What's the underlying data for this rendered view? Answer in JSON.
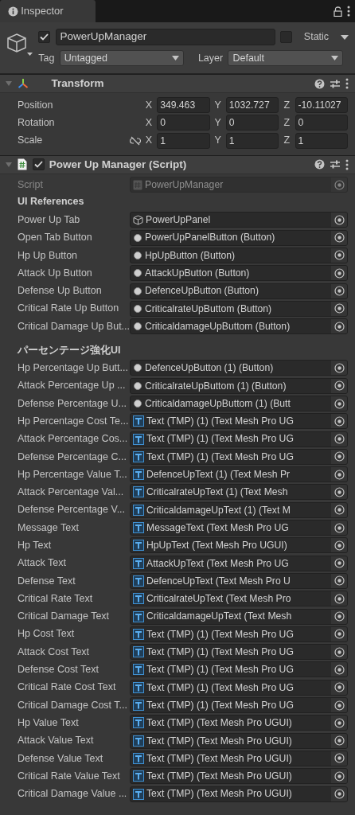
{
  "tab": {
    "title": "Inspector"
  },
  "object": {
    "active": true,
    "name": "PowerUpManager",
    "static": false,
    "static_label": "Static",
    "tag_label": "Tag",
    "tag": "Untagged",
    "layer_label": "Layer",
    "layer": "Default"
  },
  "transform": {
    "title": "Transform",
    "expanded": true,
    "rows": [
      {
        "label": "Position",
        "kind": "vector",
        "values": [
          {
            "axis": "X",
            "value": "349.463"
          },
          {
            "axis": "Y",
            "value": "1032.727"
          },
          {
            "axis": "Z",
            "value": "-10.11027"
          }
        ]
      },
      {
        "label": "Rotation",
        "kind": "vector",
        "values": [
          {
            "axis": "X",
            "value": "0"
          },
          {
            "axis": "Y",
            "value": "0"
          },
          {
            "axis": "Z",
            "value": "0"
          }
        ]
      },
      {
        "label": "Scale",
        "kind": "vector_link",
        "values": [
          {
            "axis": "X",
            "value": "1"
          },
          {
            "axis": "Y",
            "value": "1"
          },
          {
            "axis": "Z",
            "value": "1"
          }
        ]
      }
    ]
  },
  "script_component": {
    "title": "Power Up Manager (Script)",
    "expanded": true,
    "enabled": true,
    "script_label": "Script",
    "script": "PowerUpManager",
    "disabled": true
  },
  "sections": [
    {
      "heading": "UI References",
      "fields": [
        {
          "label": "Power Up Tab",
          "kind": "gameobject",
          "value": "PowerUpPanel"
        },
        {
          "label": "Open Tab Button",
          "kind": "button",
          "value": "PowerUpPanelButton (Button)"
        },
        {
          "label": "Hp Up Button",
          "kind": "button",
          "value": "HpUpButton (Button)"
        },
        {
          "label": "Attack Up Button",
          "kind": "button",
          "value": "AttackUpButton (Button)"
        },
        {
          "label": "Defense Up Button",
          "kind": "button",
          "value": "DefenceUpButton (Button)"
        },
        {
          "label": "Critical Rate Up Button",
          "kind": "button",
          "value": "CriticalrateUpButtom (Button)"
        },
        {
          "label": "Critical Damage Up But...",
          "kind": "button",
          "value": "CriticaldamageUpButtom (Button)"
        }
      ]
    },
    {
      "heading": "パーセンテージ強化UI",
      "fields": [
        {
          "label": "Hp Percentage Up Butt...",
          "kind": "button",
          "value": "DefenceUpButton (1) (Button)"
        },
        {
          "label": "Attack Percentage Up ...",
          "kind": "button",
          "value": "CriticalrateUpButtom (1) (Button)"
        },
        {
          "label": "Defense Percentage U...",
          "kind": "button",
          "value": "CriticaldamageUpButtom (1) (Butt"
        },
        {
          "label": "Hp Percentage Cost Te...",
          "kind": "tmp",
          "value": "Text (TMP) (1) (Text Mesh Pro UG"
        },
        {
          "label": "Attack Percentage Cos...",
          "kind": "tmp",
          "value": "Text (TMP) (1) (Text Mesh Pro UG"
        },
        {
          "label": "Defense Percentage C...",
          "kind": "tmp",
          "value": "Text (TMP) (1) (Text Mesh Pro UG"
        },
        {
          "label": "Hp Percentage Value T...",
          "kind": "tmp",
          "value": "DefenceUpText (1) (Text Mesh Pr"
        },
        {
          "label": "Attack Percentage Val...",
          "kind": "tmp",
          "value": "CriticalrateUpText (1) (Text Mesh"
        },
        {
          "label": "Defense Percentage V...",
          "kind": "tmp",
          "value": "CriticaldamageUpText (1) (Text M"
        },
        {
          "label": "Message Text",
          "kind": "tmp",
          "value": "MessageText (Text Mesh Pro UG"
        },
        {
          "label": "Hp Text",
          "kind": "tmp",
          "value": "HpUpText (Text Mesh Pro UGUI)"
        },
        {
          "label": "Attack Text",
          "kind": "tmp",
          "value": "AttackUpText (Text Mesh Pro UG"
        },
        {
          "label": "Defense Text",
          "kind": "tmp",
          "value": "DefenceUpText (Text Mesh Pro U"
        },
        {
          "label": "Critical Rate Text",
          "kind": "tmp",
          "value": "CriticalrateUpText (Text Mesh Pro"
        },
        {
          "label": "Critical Damage Text",
          "kind": "tmp",
          "value": "CriticaldamageUpText (Text Mesh"
        },
        {
          "label": "Hp Cost Text",
          "kind": "tmp",
          "value": "Text (TMP) (1) (Text Mesh Pro UG"
        },
        {
          "label": "Attack Cost Text",
          "kind": "tmp",
          "value": "Text (TMP) (1) (Text Mesh Pro UG"
        },
        {
          "label": "Defense Cost Text",
          "kind": "tmp",
          "value": "Text (TMP) (1) (Text Mesh Pro UG"
        },
        {
          "label": "Critical Rate Cost Text",
          "kind": "tmp",
          "value": "Text (TMP) (1) (Text Mesh Pro UG"
        },
        {
          "label": "Critical Damage Cost T...",
          "kind": "tmp",
          "value": "Text (TMP) (1) (Text Mesh Pro UG"
        },
        {
          "label": "Hp Value Text",
          "kind": "tmp",
          "value": "Text (TMP) (Text Mesh Pro UGUI)"
        },
        {
          "label": "Attack Value Text",
          "kind": "tmp",
          "value": "Text (TMP) (Text Mesh Pro UGUI)"
        },
        {
          "label": "Defense Value Text",
          "kind": "tmp",
          "value": "Text (TMP) (Text Mesh Pro UGUI)"
        },
        {
          "label": "Critical Rate Value Text",
          "kind": "tmp",
          "value": "Text (TMP) (Text Mesh Pro UGUI)"
        },
        {
          "label": "Critical Damage Value ...",
          "kind": "tmp",
          "value": "Text (TMP) (Text Mesh Pro UGUI)"
        }
      ]
    }
  ]
}
